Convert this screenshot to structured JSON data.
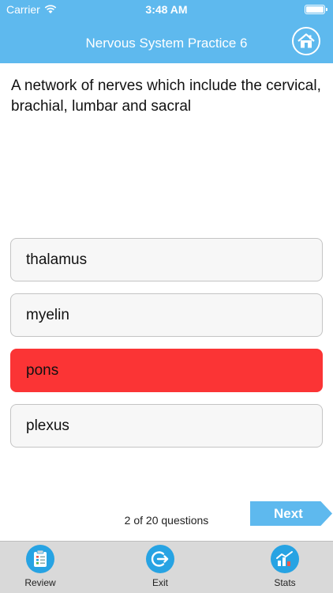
{
  "status_bar": {
    "carrier": "Carrier",
    "time": "3:48 AM"
  },
  "header": {
    "title": "Nervous System Practice 6",
    "home_icon": "home-icon"
  },
  "question": {
    "text": "A network of nerves which include the cervical, brachial, lumbar and sacral"
  },
  "answers": [
    {
      "label": "thalamus",
      "state": "default"
    },
    {
      "label": "myelin",
      "state": "default"
    },
    {
      "label": "pons",
      "state": "wrong"
    },
    {
      "label": "plexus",
      "state": "default"
    }
  ],
  "progress": {
    "text": "2 of 20 questions",
    "current": 2,
    "total": 20
  },
  "next_button": {
    "label": "Next"
  },
  "tab_bar": {
    "items": [
      {
        "label": "Review",
        "icon": "clipboard-icon"
      },
      {
        "label": "Exit",
        "icon": "exit-icon"
      },
      {
        "label": "Stats",
        "icon": "chart-icon"
      }
    ]
  },
  "colors": {
    "header": "#5eb9ee",
    "wrong": "#fb3435",
    "tab_icon": "#27a3e3",
    "tab_bar": "#d9d9d9"
  }
}
